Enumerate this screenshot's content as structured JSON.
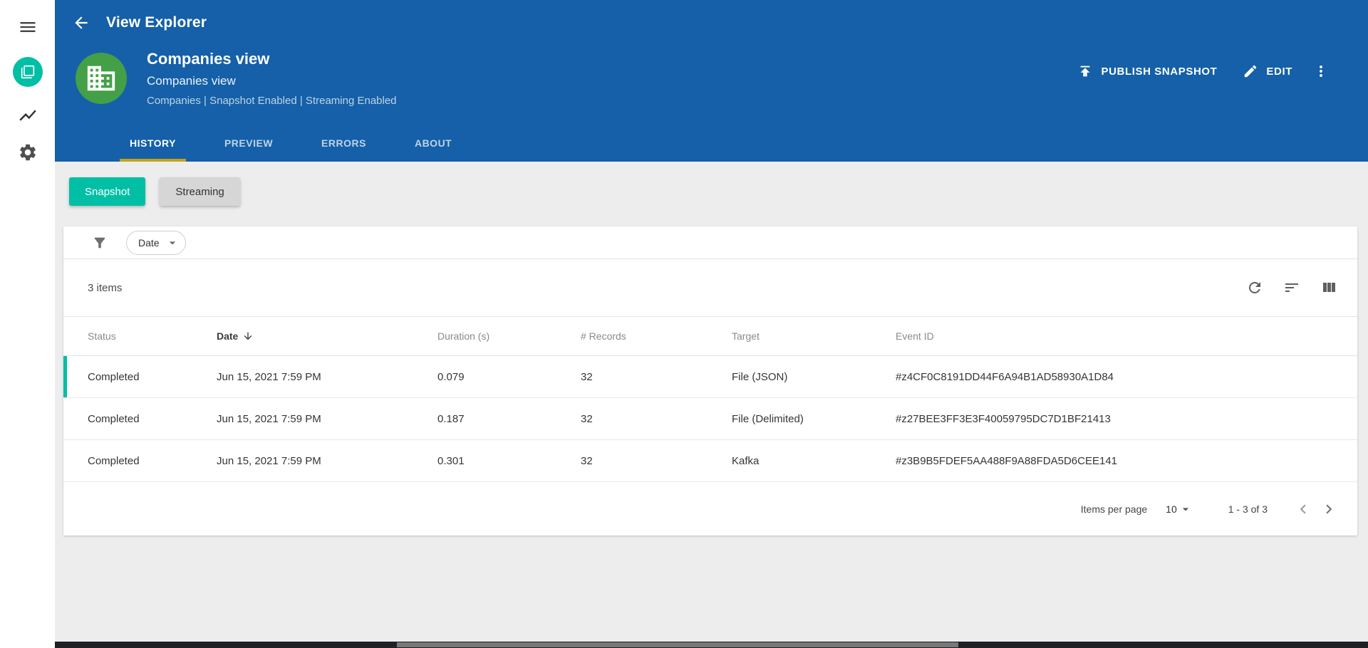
{
  "colors": {
    "header_blue": "#1560a8",
    "accent_teal": "#00bfa5",
    "avatar_green": "#43a047",
    "tab_underline": "#c5a219"
  },
  "appbar": {
    "title": "View Explorer"
  },
  "header": {
    "view": {
      "title": "Companies view",
      "subtitle": "Companies view",
      "meta": "Companies | Snapshot Enabled | Streaming Enabled"
    },
    "actions": {
      "publish": "PUBLISH SNAPSHOT",
      "edit": "EDIT"
    },
    "tabs": [
      {
        "label": "HISTORY"
      },
      {
        "label": "PREVIEW"
      },
      {
        "label": "ERRORS"
      },
      {
        "label": "ABOUT"
      }
    ]
  },
  "toggle": {
    "snapshot": "Snapshot",
    "streaming": "Streaming"
  },
  "filter": {
    "date_label": "Date"
  },
  "table": {
    "items_count": "3 items",
    "columns": [
      "Status",
      "Date",
      "Duration (s)",
      "# Records",
      "Target",
      "Event ID"
    ],
    "rows": [
      {
        "status": "Completed",
        "date": "Jun 15, 2021 7:59 PM",
        "duration": "0.079",
        "records": "32",
        "target": "File (JSON)",
        "event_id": "#z4CF0C8191DD44F6A94B1AD58930A1D84"
      },
      {
        "status": "Completed",
        "date": "Jun 15, 2021 7:59 PM",
        "duration": "0.187",
        "records": "32",
        "target": "File (Delimited)",
        "event_id": "#z27BEE3FF3E3F40059795DC7D1BF21413"
      },
      {
        "status": "Completed",
        "date": "Jun 15, 2021 7:59 PM",
        "duration": "0.301",
        "records": "32",
        "target": "Kafka",
        "event_id": "#z3B9B5FDEF5AA488F9A88FDA5D6CEE141"
      }
    ],
    "pagination": {
      "items_per_page_label": "Items per page",
      "items_per_page_value": "10",
      "range": "1 - 3 of 3"
    }
  }
}
